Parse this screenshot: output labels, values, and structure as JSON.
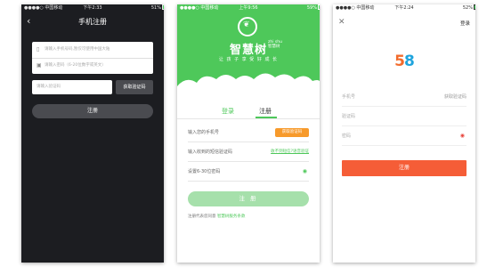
{
  "phone1": {
    "status": {
      "carrier": "●●●●○ 中国移动 ",
      "time": "下午2:33",
      "battery": "51%"
    },
    "back_icon": "chevron-left-icon",
    "title": "手机注册",
    "phone_placeholder": "请输入手机号码,暂仅可使用中国大陆",
    "password_placeholder": "请输入密码（6-20位数字或英文）",
    "code_placeholder": "请输入验证码",
    "get_code_label": "获取验证码",
    "register_label": "注册"
  },
  "phone2": {
    "status": {
      "carrier": "●●●●○ 中国移动 ",
      "time": "上午9:56",
      "battery": "59%"
    },
    "brand": "智慧树",
    "brand_en": "zhi shu\n智慧树",
    "slogan": "让 孩 子 享 受 好 成 长",
    "tabs": {
      "login": "登录",
      "register": "注册"
    },
    "phone_label": "输入您的手机号",
    "get_code_label": "获取验证码",
    "code_label": "输入收到的短信验证码",
    "voice_code_link": "收不到短信?语音验证",
    "password_label": "设置6-30位密码",
    "register_label": "注 册",
    "terms_prefix": "注册代表您同意 ",
    "terms_link": "智慧树服务条款",
    "accent": "#4ec85a"
  },
  "phone3": {
    "status": {
      "carrier": "●●●●○ 中国移动 ",
      "time": "下午2:24",
      "battery": "52%"
    },
    "close_icon": "close-icon",
    "login_link": "登录",
    "logo": {
      "d1": "5",
      "d2": "8"
    },
    "phone_label": "手机号",
    "get_code_label": "获取验证码",
    "code_label": "验证码",
    "password_label": "密码",
    "register_label": "注册",
    "accent": "#f55d37"
  }
}
